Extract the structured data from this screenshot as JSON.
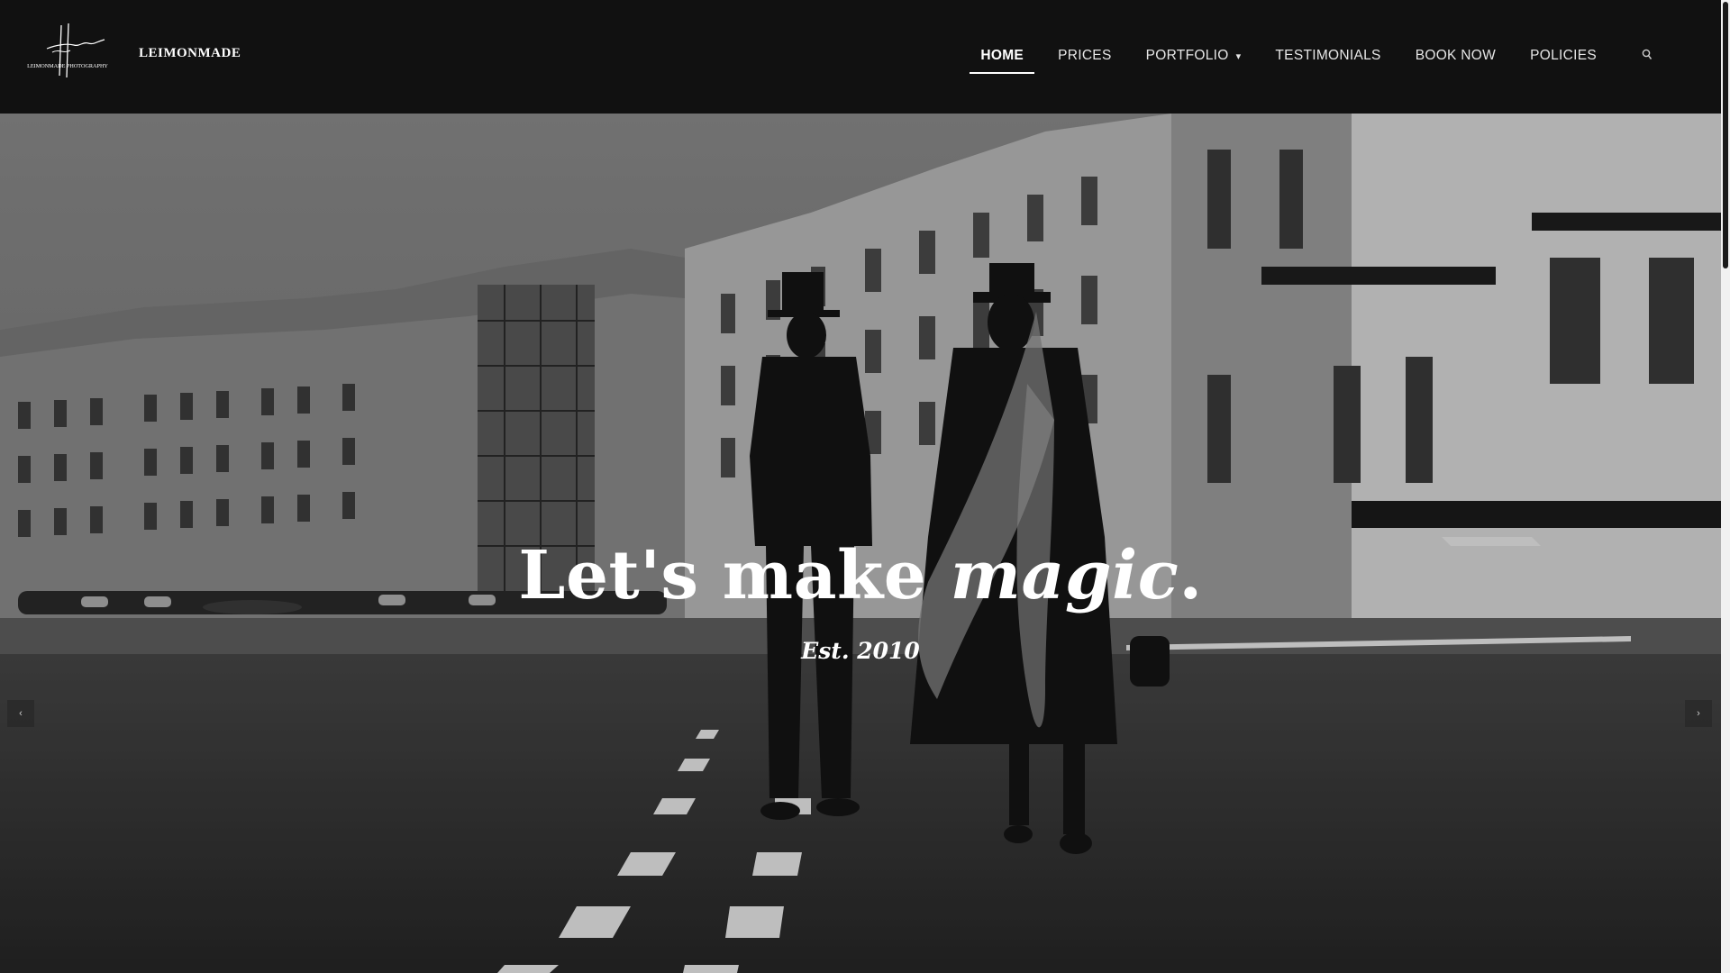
{
  "site": {
    "logo_text": "LEIMONMADE",
    "logo_mark_text": "LEIMONMADE PHOTOGRAPHY"
  },
  "nav": {
    "items": [
      {
        "label": "HOME",
        "active": true
      },
      {
        "label": "PRICES"
      },
      {
        "label": "PORTFOLIO",
        "caret": "▾"
      },
      {
        "label": "TESTIMONIALS"
      },
      {
        "label": "BOOK NOW"
      },
      {
        "label": "POLICIES"
      }
    ],
    "search_icon": "search-icon"
  },
  "hero": {
    "heading_main": "Let's make ",
    "heading_emphasis": "magic",
    "heading_end": ".",
    "subheading": "Est. 2010",
    "prev_icon": "chevron-left-icon",
    "next_icon": "chevron-right-icon",
    "prev_glyph": "‹",
    "next_glyph": "›"
  },
  "colors": {
    "header_bg": "#111111",
    "text": "#ffffff",
    "nav_text": "#e6e6e6"
  }
}
